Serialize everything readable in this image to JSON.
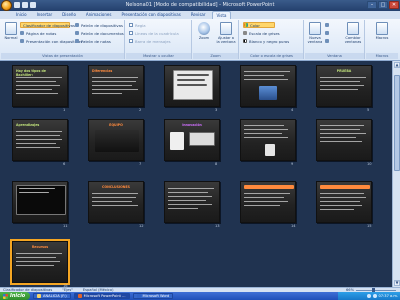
{
  "window": {
    "title": "Nelsona01 [Modo de compatibilidad] - Microsoft PowerPoint",
    "buttons": {
      "minimize": "–",
      "maximize": "□",
      "close": "✕"
    }
  },
  "tabs": [
    "Inicio",
    "Insertar",
    "Diseño",
    "Animaciones",
    "Presentación con diapositivas",
    "Revisar",
    "Vista"
  ],
  "active_tab": "Vista",
  "ribbon": {
    "groups": {
      "views": {
        "label": "Vistas de presentación",
        "normal": "Normal",
        "items": [
          "Clasificador de diapositivas",
          "Página de notas",
          "Presentación con diapositivas"
        ],
        "masters": [
          "Patrón de diapositivas",
          "Patrón de documentos",
          "Patrón de notas"
        ]
      },
      "show_hide": {
        "label": "Mostrar u ocultar",
        "items": [
          "Regla",
          "Líneas de la cuadrícula",
          "Barra de mensajes"
        ]
      },
      "zoom": {
        "label": "Zoom",
        "zoom_label": "Zoom",
        "fit_label": "Ajustar a la ventana"
      },
      "color": {
        "label": "Color o escala de grises",
        "items": [
          "Color",
          "Escala de grises",
          "Blanco y negro puros"
        ]
      },
      "window": {
        "label": "Ventana",
        "new_window": "Nueva ventana",
        "switch": "Cambiar ventanas"
      },
      "macros": {
        "label": "Macros",
        "macros_label": "Macros"
      }
    }
  },
  "slides": [
    {
      "num": "1",
      "title": "Hay dos tipos de Bachiller:"
    },
    {
      "num": "2",
      "title": "Diferencias"
    },
    {
      "num": "3",
      "title": ""
    },
    {
      "num": "4",
      "title": ""
    },
    {
      "num": "5",
      "title": "PRUEBA"
    },
    {
      "num": "6",
      "title": "Aprendizajes"
    },
    {
      "num": "7",
      "title": "EQUIPO"
    },
    {
      "num": "8",
      "title": "Innovación"
    },
    {
      "num": "9",
      "title": ""
    },
    {
      "num": "10",
      "title": ""
    },
    {
      "num": "11",
      "title": ""
    },
    {
      "num": "12",
      "title": "CONCLUSIONES"
    },
    {
      "num": "13",
      "title": ""
    },
    {
      "num": "14",
      "title": ""
    },
    {
      "num": "15",
      "title": ""
    },
    {
      "num": "16",
      "title": "Recursos"
    }
  ],
  "status": {
    "view": "Clasificador de diapositivas",
    "theme": "\"Ejes\"",
    "language": "Español (México)",
    "zoom": "66%"
  },
  "taskbar": {
    "start": "Inicio",
    "tasks": [
      "ANALICIA (F:)",
      "Microsoft PowerPoint ...",
      "Microsoft Word"
    ],
    "clock": "07:37 a.m."
  }
}
